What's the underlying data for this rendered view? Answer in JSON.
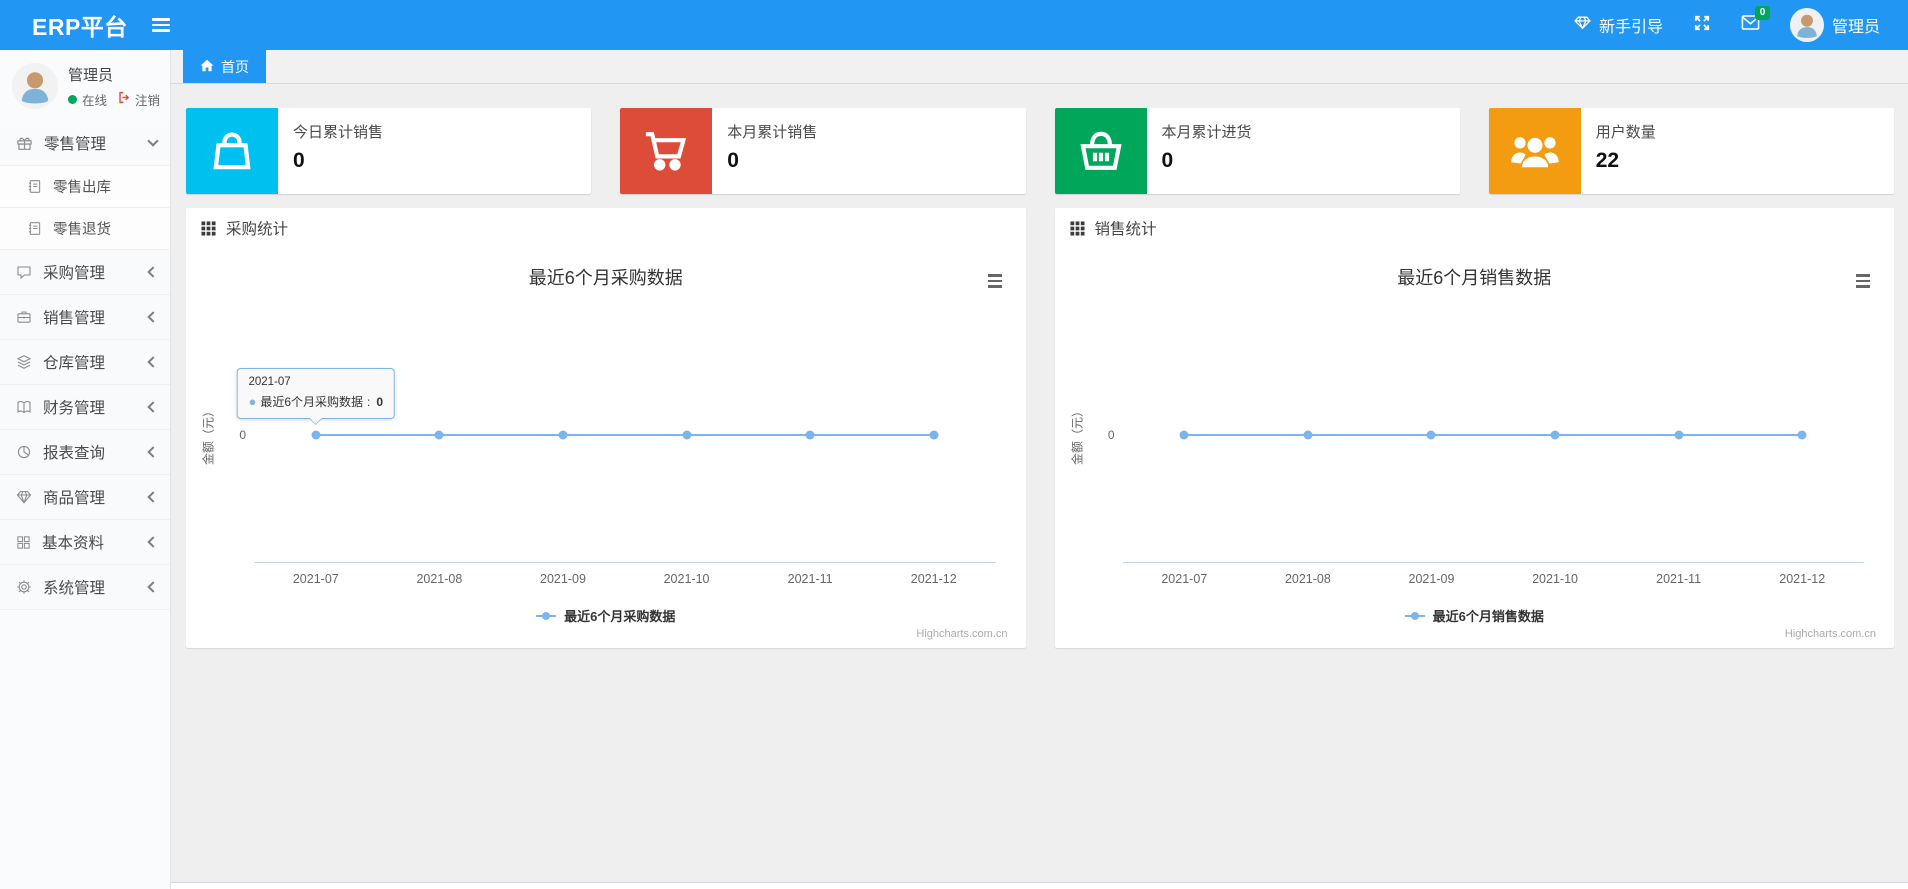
{
  "colors": {
    "accent": "#2196f3",
    "badge": "#00a65a",
    "line": "#7cb5ec"
  },
  "header": {
    "brand": "ERP平台",
    "guide_label": "新手引导",
    "mail_badge": "0",
    "user_name": "管理员"
  },
  "sidebar": {
    "user": {
      "name": "管理员",
      "status": "在线",
      "logout": "注销"
    },
    "menu": [
      {
        "id": "retail",
        "label": "零售管理",
        "icon": "gift-icon",
        "state": "expanded",
        "children": [
          {
            "id": "retail-outbound",
            "label": "零售出库",
            "icon": "book-icon"
          },
          {
            "id": "retail-return",
            "label": "零售退货",
            "icon": "book-icon"
          }
        ]
      },
      {
        "id": "purchase",
        "label": "采购管理",
        "icon": "comment-icon",
        "state": "collapsed"
      },
      {
        "id": "sales",
        "label": "销售管理",
        "icon": "briefcase-icon",
        "state": "collapsed"
      },
      {
        "id": "warehouse",
        "label": "仓库管理",
        "icon": "layers-icon",
        "state": "collapsed"
      },
      {
        "id": "finance",
        "label": "财务管理",
        "icon": "ledger-icon",
        "state": "collapsed"
      },
      {
        "id": "report",
        "label": "报表查询",
        "icon": "pie-chart-icon",
        "state": "collapsed"
      },
      {
        "id": "goods",
        "label": "商品管理",
        "icon": "gem-icon",
        "state": "collapsed"
      },
      {
        "id": "basic-data",
        "label": "基本资料",
        "icon": "grid-icon",
        "state": "collapsed"
      },
      {
        "id": "system",
        "label": "系统管理",
        "icon": "gear-icon",
        "state": "collapsed"
      }
    ]
  },
  "tabs": [
    {
      "label": "首页",
      "icon": "home-icon",
      "active": true
    }
  ],
  "stat_cards": [
    {
      "id": "today-sales",
      "title": "今日累计销售",
      "value": "0",
      "icon": "bag-icon",
      "color": "#00c0ef"
    },
    {
      "id": "month-sales",
      "title": "本月累计销售",
      "value": "0",
      "icon": "cart-icon",
      "color": "#dd4b39"
    },
    {
      "id": "month-purchase",
      "title": "本月累计进货",
      "value": "0",
      "icon": "basket-icon",
      "color": "#00a65a"
    },
    {
      "id": "user-count",
      "title": "用户数量",
      "value": "22",
      "icon": "users-icon",
      "color": "#f39c12"
    }
  ],
  "panels": [
    {
      "id": "purchase-stats",
      "title": "采购统计",
      "icon": "th-grid-icon"
    },
    {
      "id": "sales-stats",
      "title": "销售统计",
      "icon": "th-grid-icon"
    }
  ],
  "chart_data": [
    {
      "type": "line",
      "title": "最近6个月采购数据",
      "categories": [
        "2021-07",
        "2021-08",
        "2021-09",
        "2021-10",
        "2021-11",
        "2021-12"
      ],
      "series": [
        {
          "name": "最近6个月采购数据",
          "values": [
            0,
            0,
            0,
            0,
            0,
            0
          ],
          "color": "#7cb5ec"
        }
      ],
      "xlabel": "",
      "ylabel": "金额（元）",
      "ylim": [
        -1,
        1
      ],
      "yticks": [
        "0"
      ],
      "grid": false,
      "legend_position": "bottom",
      "credits": "Highcharts.com.cn",
      "tooltip": {
        "visible": true,
        "category": "2021-07",
        "series_name": "最近6个月采购数据",
        "value": "0",
        "anchor_index": 0
      }
    },
    {
      "type": "line",
      "title": "最近6个月销售数据",
      "categories": [
        "2021-07",
        "2021-08",
        "2021-09",
        "2021-10",
        "2021-11",
        "2021-12"
      ],
      "series": [
        {
          "name": "最近6个月销售数据",
          "values": [
            0,
            0,
            0,
            0,
            0,
            0
          ],
          "color": "#7cb5ec"
        }
      ],
      "xlabel": "",
      "ylabel": "金额（元）",
      "ylim": [
        -1,
        1
      ],
      "yticks": [
        "0"
      ],
      "grid": false,
      "legend_position": "bottom",
      "credits": "Highcharts.com.cn",
      "tooltip": {
        "visible": false
      }
    }
  ]
}
